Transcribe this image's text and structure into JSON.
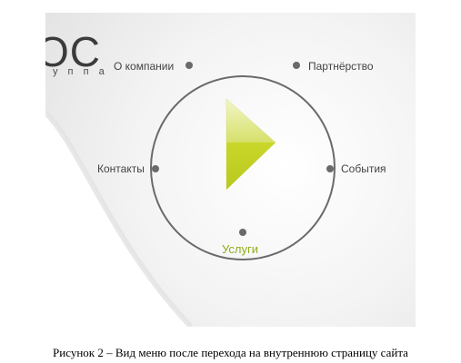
{
  "logo": {
    "big_text": "ОС",
    "small_text": "у п п а"
  },
  "menu": {
    "items": [
      {
        "id": "about",
        "label": "О компании"
      },
      {
        "id": "partnership",
        "label": "Партнёрство"
      },
      {
        "id": "contacts",
        "label": "Контакты"
      },
      {
        "id": "events",
        "label": "События"
      },
      {
        "id": "services",
        "label": "Услуги",
        "active": true
      }
    ]
  },
  "play_icon": "play-triangle-icon",
  "colors": {
    "accent": "#c6d624",
    "active_label": "#8fae1b",
    "circle": "#6a6a6a"
  },
  "caption": "Рисунок 2 – Вид меню после перехода на внутреннюю страницу сайта"
}
